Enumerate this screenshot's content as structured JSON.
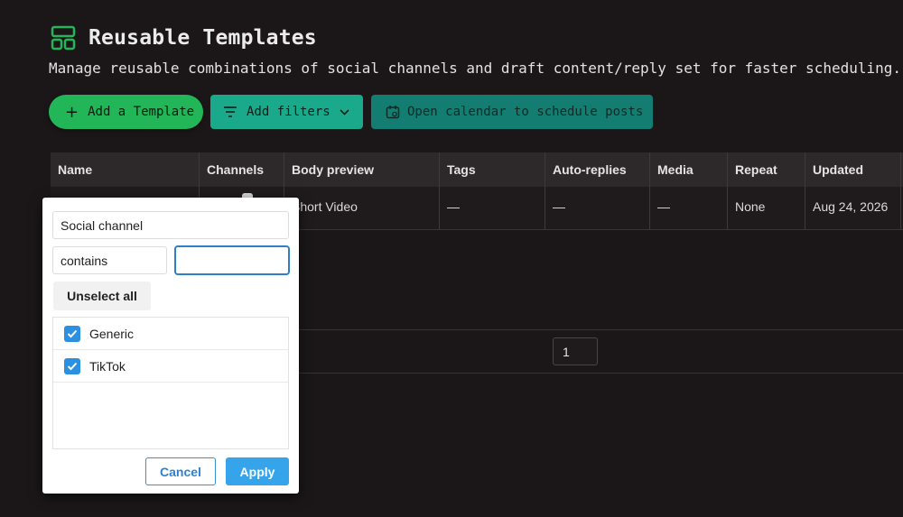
{
  "header": {
    "title": "Reusable Templates",
    "subtitle": "Manage reusable combinations of social channels and draft content/reply set for faster scheduling.",
    "icon": "layout-icon"
  },
  "toolbar": {
    "add_label": "Add a Template",
    "filters_label": "Add filters",
    "calendar_label": "Open calendar to schedule posts"
  },
  "table": {
    "columns": [
      "Name",
      "Channels",
      "Body preview",
      "Tags",
      "Auto-replies",
      "Media",
      "Repeat",
      "Updated"
    ],
    "rows": [
      {
        "body": "Short Video",
        "tags": "—",
        "auto_replies": "—",
        "media": "—",
        "repeat": "None",
        "updated": "Aug 24, 2026"
      }
    ]
  },
  "pagination": {
    "page": "1"
  },
  "filter_popover": {
    "field": "Social channel",
    "operator": "contains",
    "value": "",
    "unselect_label": "Unselect all",
    "options": [
      {
        "label": "Generic",
        "checked": true
      },
      {
        "label": "TikTok",
        "checked": true
      }
    ],
    "cancel_label": "Cancel",
    "apply_label": "Apply"
  },
  "colors": {
    "background": "#1b1718",
    "primary_green": "#22b658",
    "teal": "#1aa98a",
    "dark_teal": "#147d72",
    "apply_blue": "#36a4ea"
  }
}
